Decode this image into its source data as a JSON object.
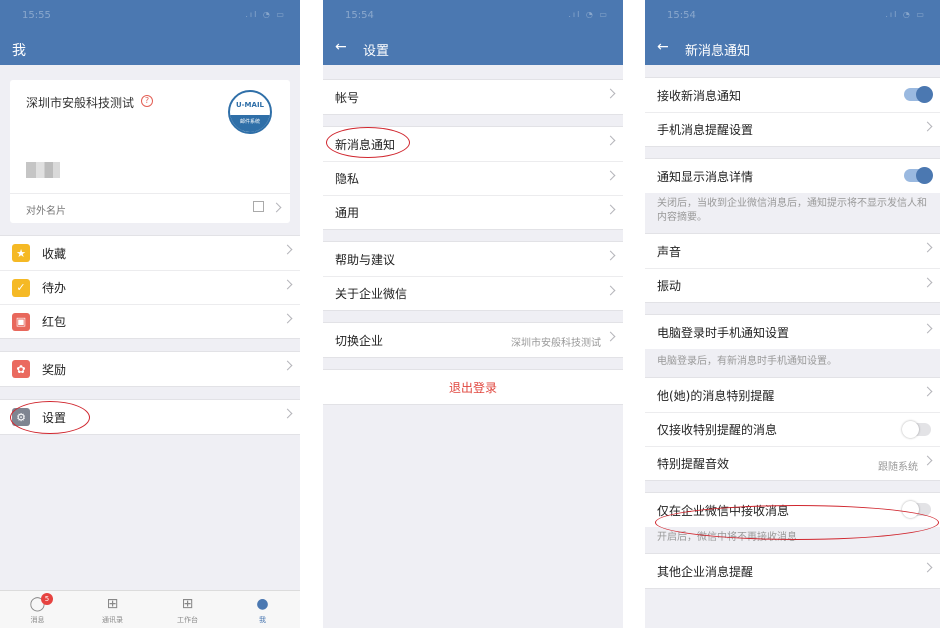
{
  "status_time": "15:55",
  "status_time2": "15:54",
  "status_time3": "15:54",
  "status_icons": ".ıl ◔ ▭",
  "panel1": {
    "title": "我",
    "card": {
      "company": "深圳市安般科技测试",
      "help_icon": "?",
      "logo_top": "U-MAIL",
      "logo_bottom": "邮件系统",
      "footer": "对外名片"
    },
    "items1": [
      {
        "label": "收藏",
        "icon": "star-icon",
        "color": "#f5b925",
        "glyph": "★"
      },
      {
        "label": "待办",
        "icon": "check-icon",
        "color": "#f5b925",
        "glyph": "✓"
      },
      {
        "label": "红包",
        "icon": "red-packet-icon",
        "color": "#e8685c",
        "glyph": "▣"
      }
    ],
    "items2": [
      {
        "label": "奖励",
        "icon": "reward-icon",
        "color": "#ea6a5f",
        "glyph": "✿"
      }
    ],
    "items3": [
      {
        "label": "设置",
        "icon": "gear-icon",
        "color": "#7f8591",
        "glyph": "⚙"
      }
    ],
    "tabs": [
      {
        "label": "消息",
        "icon": "chat-icon",
        "glyph": "◯",
        "badge": "5"
      },
      {
        "label": "通讯录",
        "icon": "org-chart-icon",
        "glyph": "⊞"
      },
      {
        "label": "工作台",
        "icon": "grid-icon",
        "glyph": "⊞"
      },
      {
        "label": "我",
        "icon": "person-icon",
        "glyph": "●"
      }
    ]
  },
  "panel2": {
    "back": "←",
    "title": "设置",
    "groups": [
      [
        "帐号"
      ],
      [
        "新消息通知",
        "隐私",
        "通用"
      ],
      [
        "帮助与建议",
        "关于企业微信"
      ]
    ],
    "switch_label": "切换企业",
    "switch_value": "深圳市安般科技测试",
    "logout": "退出登录"
  },
  "panel3": {
    "back": "←",
    "title": "新消息通知",
    "receive_new": "接收新消息通知",
    "phone_settings": "手机消息提醒设置",
    "show_detail": "通知显示消息详情",
    "show_detail_hint": "关闭后，当收到企业微信消息后，通知提示将不显示发信人和内容摘要。",
    "sound": "声音",
    "vibrate": "振动",
    "pc_login": "电脑登录时手机通知设置",
    "pc_login_hint": "电脑登录后，有新消息时手机通知设置。",
    "special_remind": "他(她)的消息特别提醒",
    "only_special": "仅接收特别提醒的消息",
    "special_sound": "特别提醒音效",
    "special_sound_value": "跟随系统",
    "only_wework": "仅在企业微信中接收消息",
    "only_wework_hint": "开启后，微信中将不再接收消息",
    "other_company": "其他企业消息提醒"
  }
}
